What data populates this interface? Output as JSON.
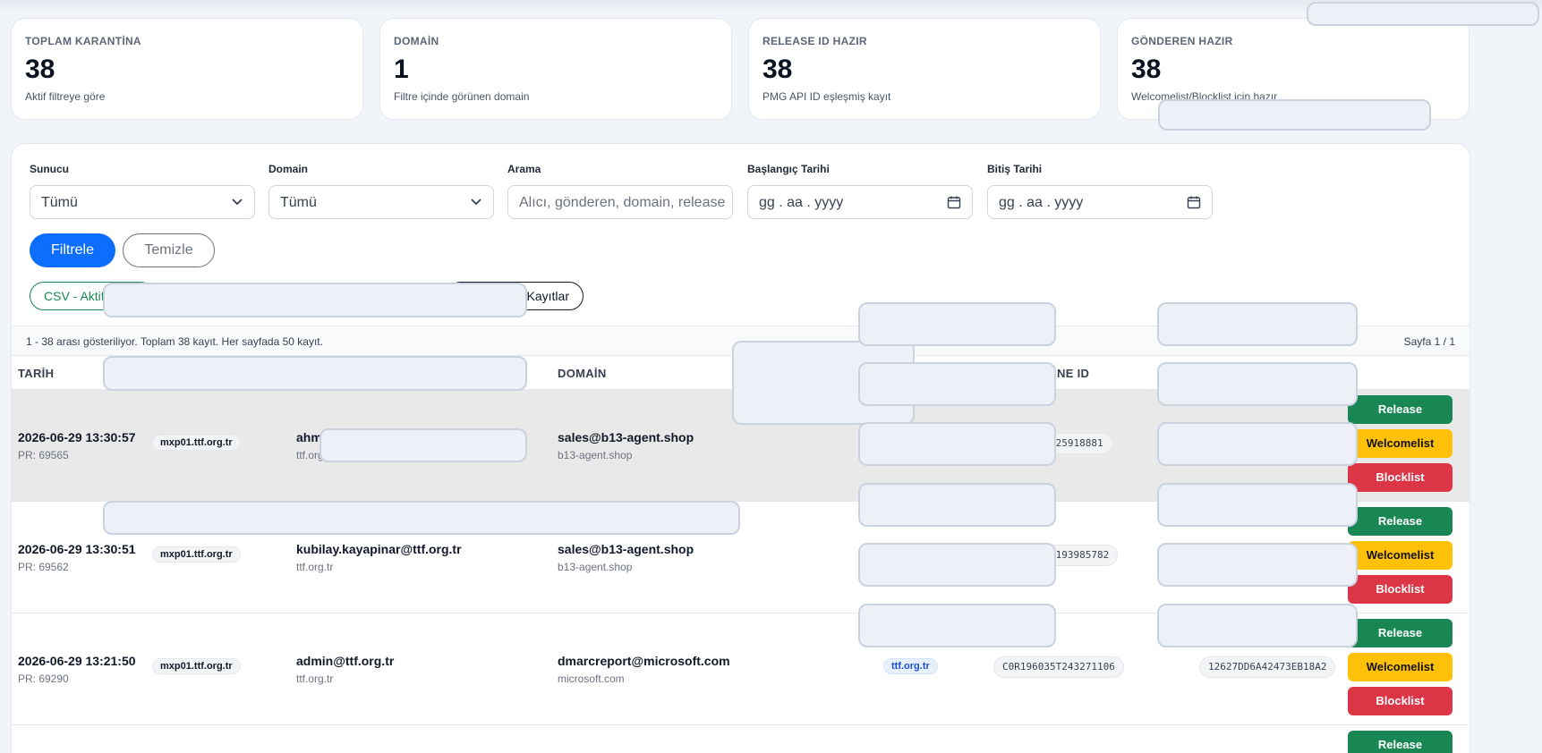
{
  "stats": [
    {
      "label": "TOPLAM KARANTİNA",
      "value": "38",
      "sub": "Aktif filtreye göre"
    },
    {
      "label": "DOMAİN",
      "value": "1",
      "sub": "Filtre içinde görünen domain"
    },
    {
      "label": "RELEASE ID HAZIR",
      "value": "38",
      "sub": "PMG API ID eşleşmiş kayıt"
    },
    {
      "label": "GÖNDEREN HAZIR",
      "value": "38",
      "sub": "Welcomelist/Blocklist için hazır"
    }
  ],
  "filters": {
    "server_label": "Sunucu",
    "server_value": "Tümü",
    "domain_label": "Domain",
    "domain_value": "Tümü",
    "search_label": "Arama",
    "search_placeholder": "Alıcı, gönderen, domain, release",
    "start_label": "Başlangıç Tarihi",
    "start_placeholder": "gg . aa . yyyy",
    "end_label": "Bitiş Tarihi",
    "end_placeholder": "gg . aa . yyyy",
    "filter_button": "Filtrele",
    "clear_button": "Temizle",
    "export_csv": "CSV - Aktif",
    "records_pill": "Kayıtlar"
  },
  "info": {
    "range": "1 - 38 arası gösteriliyor. Toplam 38 kayıt. Her sayfada 50 kayıt.",
    "page": "Sayfa 1 / 1"
  },
  "columns": {
    "date": "TARİH",
    "sender_domain": "DOMAİN",
    "queue_id_fragment": "NE ID"
  },
  "rows": [
    {
      "date": "2026-06-29 13:30:57",
      "pr": "PR: 69565",
      "server": "mxp01.ttf.org.tr",
      "recipient": "ahm",
      "recipient_domain": "ttf.org",
      "sender": "sales@b13-agent.shop",
      "sender_domain": "b13-agent.shop",
      "domain_tag": "",
      "queue_id": "T25918881",
      "release_id": "",
      "highlight": true
    },
    {
      "date": "2026-06-29 13:30:51",
      "pr": "PR: 69562",
      "server": "mxp01.ttf.org.tr",
      "recipient": "kubilay.kayapinar@ttf.org.tr",
      "recipient_domain": "ttf.org.tr",
      "sender": "sales@b13-agent.shop",
      "sender_domain": "b13-agent.shop",
      "domain_tag": "",
      "queue_id": "T193985782",
      "release_id": "",
      "highlight": false
    },
    {
      "date": "2026-06-29 13:21:50",
      "pr": "PR: 69290",
      "server": "mxp01.ttf.org.tr",
      "recipient": "admin@ttf.org.tr",
      "recipient_domain": "ttf.org.tr",
      "sender": "dmarcreport@microsoft.com",
      "sender_domain": "microsoft.com",
      "domain_tag": "ttf.org.tr",
      "queue_id": "C0R196035T243271106",
      "release_id": "12627DD6A42473EB18A2",
      "highlight": false
    }
  ],
  "actions": {
    "release": "Release",
    "welcomelist": "Welcomelist",
    "blocklist": "Blocklist"
  },
  "colors": {
    "primary": "#0d6efd",
    "release": "#198754",
    "welcomelist": "#ffc107",
    "blocklist": "#dc3545"
  }
}
